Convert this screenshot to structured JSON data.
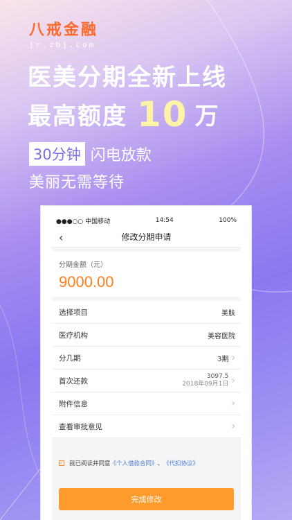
{
  "brand": {
    "name": "八戒金融",
    "domain": "jr.zbj.com",
    "accent": "#ff6a2b"
  },
  "hero": {
    "line1": "医美分期全新上线",
    "line2_prefix": "最高额度",
    "line2_amount": "10",
    "line2_unit": "万",
    "tag_highlight": "30分钟",
    "tag_rest": "闪电放款",
    "line4": "美丽无需等待"
  },
  "status_bar": {
    "carrier": "●●●○○ 中国移动",
    "time": "14:54",
    "battery": "100%"
  },
  "nav": {
    "title": "修改分期申请",
    "back_icon": "chevron-left-icon"
  },
  "amount": {
    "label": "分期金额（元）",
    "value": "9000.00"
  },
  "rows": [
    {
      "label": "选择项目",
      "value": "美肤"
    },
    {
      "label": "医疗机构",
      "value": "美容医院"
    },
    {
      "label": "分几期",
      "value": "3期"
    },
    {
      "label": "首次还款",
      "value": "3097.5",
      "sub": "2018年09月1日"
    },
    {
      "label": "附件信息",
      "value": ""
    },
    {
      "label": "查看审批意见",
      "value": ""
    }
  ],
  "agreement": {
    "prefix": "我已阅读并同意",
    "link1": "《个人借款合同》",
    "sep": "、",
    "link2": "《代扣协议》"
  },
  "submit_label": "完成修改",
  "colors": {
    "orange": "#ff9a2c",
    "amount": "#ff7d1a",
    "link": "#4a7bd6",
    "purple": "#8b78f0"
  }
}
